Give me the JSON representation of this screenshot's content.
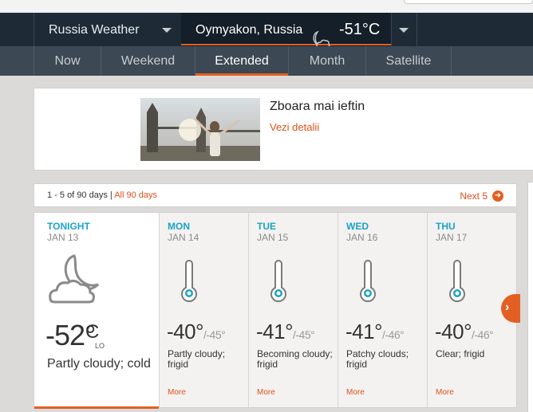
{
  "header": {
    "country_label": "Russia Weather",
    "city_label": "Oymyakon, Russia",
    "current_temp": "-51°C",
    "current_icon": "moon-cloud-icon"
  },
  "nav": {
    "tabs": [
      {
        "label": "Now"
      },
      {
        "label": "Weekend"
      },
      {
        "label": "Extended"
      },
      {
        "label": "Month"
      },
      {
        "label": "Satellite"
      }
    ],
    "active": "Extended"
  },
  "ad": {
    "title": "Zboara mai ieftin",
    "link": "Vezi detalii"
  },
  "pager": {
    "range": "1 - 5 of 90 days",
    "separator": "|",
    "all_link": "All 90 days",
    "next_label": "Next 5",
    "next_icon": "arrow-right-icon"
  },
  "tonight": {
    "name": "TONIGHT",
    "date": "JAN 13",
    "icon": "moon-cloud-icon",
    "temp": "-52°",
    "unit": "C",
    "lo_label": "LO",
    "desc": "Partly cloudy; cold"
  },
  "days": [
    {
      "name": "MON",
      "date": "JAN 14",
      "hi": "-40°",
      "lo": "/-45°",
      "desc": "Partly cloudy; frigid",
      "more": "More",
      "icon": "thermometer-icon"
    },
    {
      "name": "TUE",
      "date": "JAN 15",
      "hi": "-41°",
      "lo": "/-45°",
      "desc": "Becoming cloudy; frigid",
      "more": "More",
      "icon": "thermometer-icon"
    },
    {
      "name": "WED",
      "date": "JAN 16",
      "hi": "-41°",
      "lo": "/-46°",
      "desc": "Patchy clouds; frigid",
      "more": "More",
      "icon": "thermometer-icon"
    },
    {
      "name": "THU",
      "date": "JAN 17",
      "hi": "-40°",
      "lo": "/-46°",
      "desc": "Clear; frigid",
      "more": "More",
      "icon": "thermometer-icon"
    }
  ],
  "colors": {
    "accent": "#e35f23",
    "day_name": "#1ba3c6",
    "header_bg": "#1e2b37",
    "nav_bg": "#3c4853"
  }
}
